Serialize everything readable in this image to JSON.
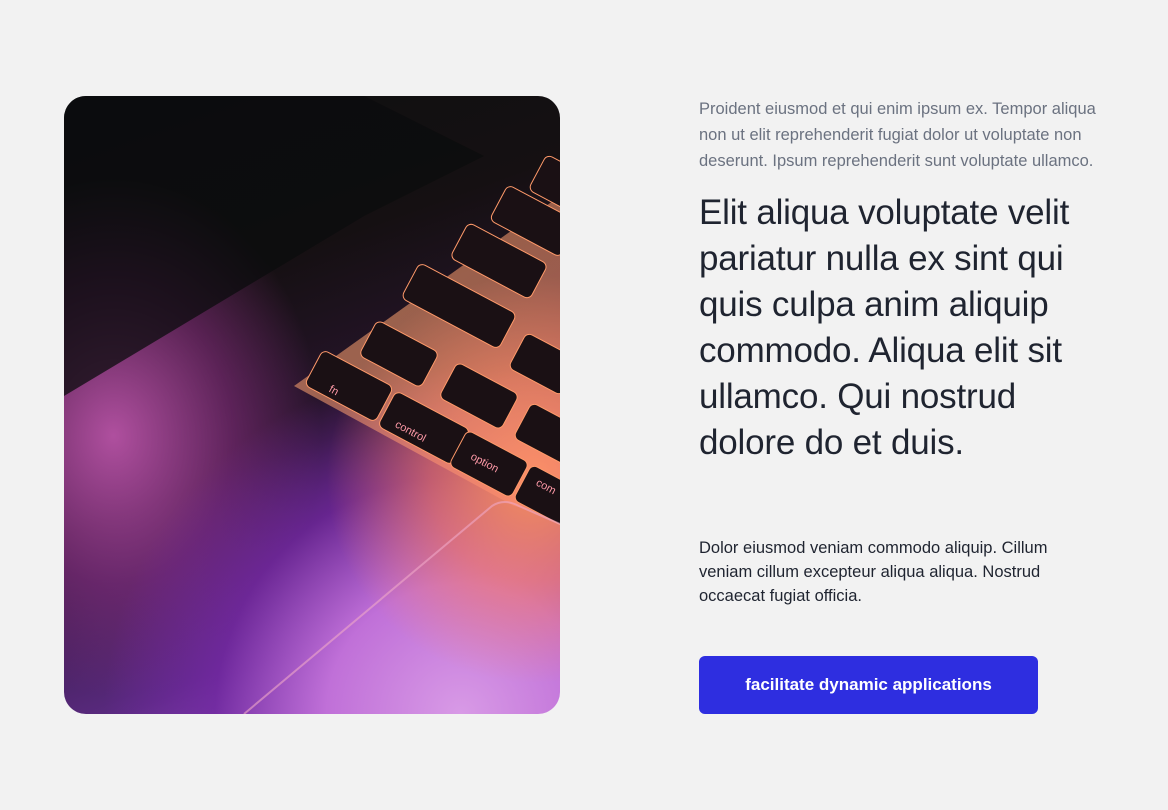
{
  "hero_image": {
    "description_icon": "laptop-keyboard-photo",
    "key_labels": [
      "fn",
      "control",
      "option",
      "com"
    ]
  },
  "content": {
    "lead": "Proident eiusmod et qui enim ipsum ex. Tempor aliqua non ut elit reprehenderit fugiat dolor ut voluptate non deserunt. Ipsum reprehenderit sunt voluptate ullamco.",
    "headline": "Elit aliqua voluptate velit pariatur nulla ex sint qui quis culpa anim aliquip commodo. Aliqua elit sit ullamco. Qui nostrud dolore do et duis.",
    "body": "Dolor eiusmod veniam commodo aliquip. Cillum veniam cillum excepteur aliqua aliqua. Nostrud occaecat fugiat officia.",
    "cta_label": "facilitate dynamic applications"
  },
  "colors": {
    "background": "#f2f2f2",
    "cta": "#2e2ee0",
    "heading": "#1f2430",
    "muted": "#6b7280"
  }
}
